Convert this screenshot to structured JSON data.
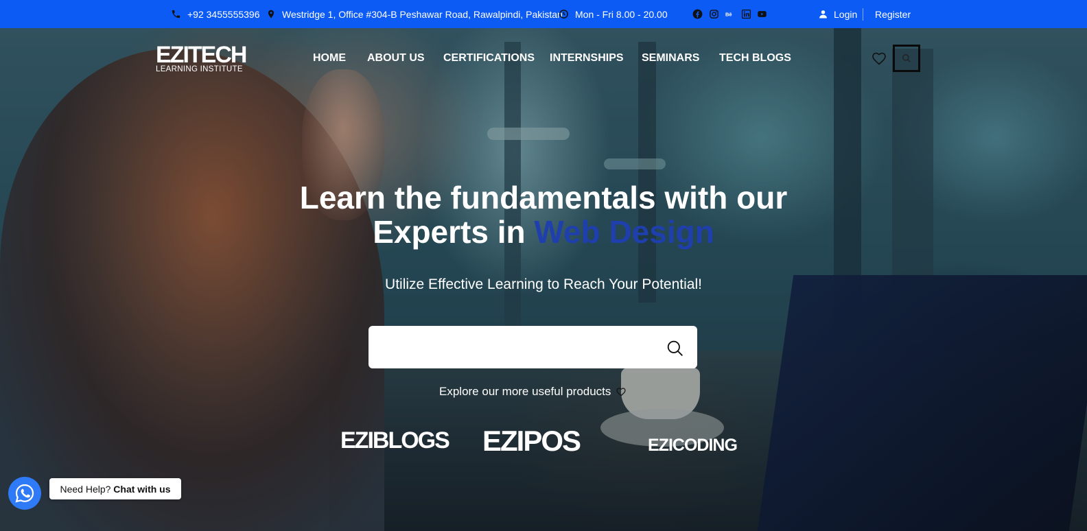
{
  "topbar": {
    "phone": "+92 3455555396",
    "address": "Westridge 1, Office #304-B Peshawar Road, Rawalpindi, Pakistan",
    "hours": "Mon - Fri 8.00 - 20.00",
    "social_icons": [
      "facebook-icon",
      "instagram-icon",
      "behance-icon",
      "linkedin-icon",
      "youtube-icon"
    ],
    "login": "Login",
    "register": "Register",
    "bg_color": "#0d5bf5"
  },
  "header": {
    "logo_main": "EZITECH",
    "logo_sub": "LEARNING INSTITUTE",
    "nav": [
      "HOME",
      "ABOUT US",
      "CERTIFICATIONS",
      "INTERNSHIPS",
      "SEMINARS",
      "TECH BLOGS"
    ]
  },
  "hero": {
    "title_line1": "Learn the fundamentals with our",
    "title_line2_prefix": "Experts in ",
    "title_highlight": "Web Design",
    "highlight_color": "#1f3fad",
    "subtitle": "Utilize Effective Learning to Reach Your Potential!",
    "search": {
      "value": "",
      "placeholder": ""
    },
    "explore_text": "Explore our more useful products",
    "products": [
      "EZIBLOGS",
      "EZIPOS",
      "EZICODING"
    ]
  },
  "chat": {
    "prefix": "Need Help?",
    "bold": "Chat with us",
    "button_color": "#2f7af7"
  }
}
